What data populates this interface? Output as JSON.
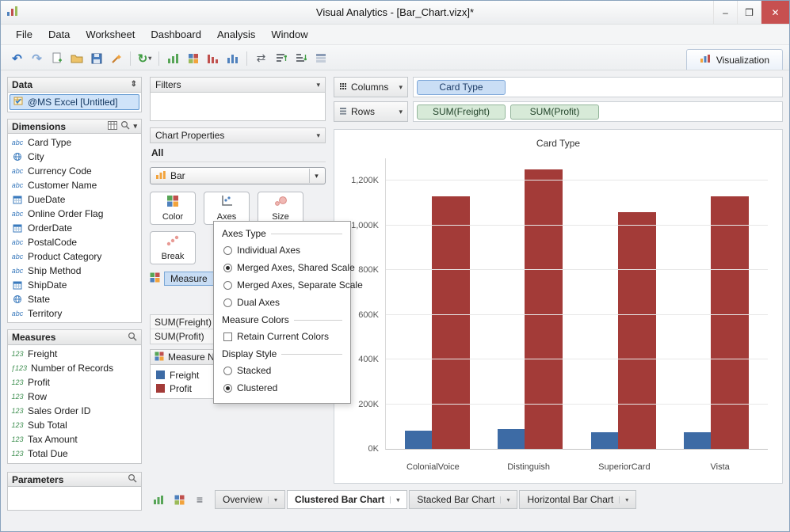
{
  "window": {
    "title": "Visual Analytics - [Bar_Chart.vizx]*",
    "minimize": "–",
    "maximize": "❒",
    "close": "✕"
  },
  "menu": {
    "items": [
      "File",
      "Data",
      "Worksheet",
      "Dashboard",
      "Analysis",
      "Window"
    ]
  },
  "toolbar": {
    "visualization_tab": "Visualization"
  },
  "data_panel": {
    "title": "Data",
    "source": "@MS Excel [Untitled]",
    "dimensions": {
      "title": "Dimensions",
      "items": [
        {
          "type": "abc",
          "label": "Card Type"
        },
        {
          "type": "globe",
          "label": "City"
        },
        {
          "type": "abc",
          "label": "Currency Code"
        },
        {
          "type": "abc",
          "label": "Customer Name"
        },
        {
          "type": "date",
          "label": "DueDate"
        },
        {
          "type": "abc",
          "label": "Online Order Flag"
        },
        {
          "type": "date",
          "label": "OrderDate"
        },
        {
          "type": "abc",
          "label": "PostalCode"
        },
        {
          "type": "abc",
          "label": "Product Category"
        },
        {
          "type": "abc",
          "label": "Ship Method"
        },
        {
          "type": "date",
          "label": "ShipDate"
        },
        {
          "type": "globe",
          "label": "State"
        },
        {
          "type": "abc",
          "label": "Territory"
        }
      ]
    },
    "measures": {
      "title": "Measures",
      "items": [
        {
          "type": "num",
          "label": "Freight"
        },
        {
          "type": "numf",
          "label": "Number of Records"
        },
        {
          "type": "num",
          "label": "Profit"
        },
        {
          "type": "num",
          "label": "Row"
        },
        {
          "type": "num",
          "label": "Sales Order ID"
        },
        {
          "type": "num",
          "label": "Sub Total"
        },
        {
          "type": "num",
          "label": "Tax Amount"
        },
        {
          "type": "num",
          "label": "Total Due"
        }
      ]
    },
    "parameters": {
      "title": "Parameters"
    }
  },
  "binding_panel": {
    "filters_title": "Filters",
    "chart_properties_title": "Chart Properties",
    "scope_label": "All",
    "chart_type": "Bar",
    "color_label": "Color",
    "axes_label": "Axes",
    "size_label": "Size",
    "break_label": "Break",
    "measure_pill": "Measure",
    "fields": [
      "SUM(Freight)",
      "SUM(Profit)"
    ],
    "legend": {
      "title": "Measure N...",
      "items": [
        {
          "label": "Freight",
          "color": "#3d6ba5"
        },
        {
          "label": "Profit",
          "color": "#a33b38"
        }
      ]
    }
  },
  "axes_popup": {
    "groups": [
      {
        "title": "Axes Type",
        "type": "radio",
        "options": [
          {
            "label": "Individual Axes",
            "selected": false
          },
          {
            "label": "Merged Axes, Shared Scale",
            "selected": true
          },
          {
            "label": "Merged Axes, Separate Scale",
            "selected": false
          },
          {
            "label": "Dual Axes",
            "selected": false
          }
        ]
      },
      {
        "title": "Measure Colors",
        "type": "checkbox",
        "options": [
          {
            "label": "Retain Current Colors",
            "selected": false
          }
        ]
      },
      {
        "title": "Display Style",
        "type": "radio",
        "options": [
          {
            "label": "Stacked",
            "selected": false
          },
          {
            "label": "Clustered",
            "selected": true
          }
        ]
      }
    ]
  },
  "shelves": {
    "columns_label": "Columns",
    "rows_label": "Rows",
    "columns_pills": [
      "Card Type"
    ],
    "rows_pills": [
      "SUM(Freight)",
      "SUM(Profit)"
    ]
  },
  "chart_data": {
    "type": "bar",
    "title": "Card Type",
    "categories": [
      "ColonialVoice",
      "Distinguish",
      "SuperiorCard",
      "Vista"
    ],
    "series": [
      {
        "name": "Freight",
        "color": "#3d6ba5",
        "values": [
          80000,
          90000,
          75000,
          75000
        ]
      },
      {
        "name": "Profit",
        "color": "#a33b38",
        "values": [
          1130000,
          1250000,
          1060000,
          1130000
        ]
      }
    ],
    "y_ticks": [
      "0K",
      "200K",
      "400K",
      "600K",
      "800K",
      "1,000K",
      "1,200K"
    ],
    "y_tick_values": [
      0,
      200000,
      400000,
      600000,
      800000,
      1000000,
      1200000
    ],
    "ylim": [
      0,
      1300000
    ],
    "grid": true,
    "legend_position": "left-panel"
  },
  "bottom_bar": {
    "tabs": [
      {
        "label": "Overview",
        "active": false
      },
      {
        "label": "Clustered Bar Chart",
        "active": true
      },
      {
        "label": "Stacked Bar Chart",
        "active": false
      },
      {
        "label": "Horizontal Bar Chart",
        "active": false
      }
    ]
  }
}
